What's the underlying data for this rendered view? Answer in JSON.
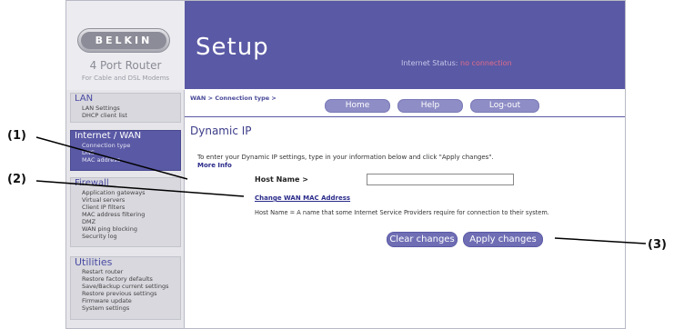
{
  "brand": {
    "logo": "BELKIN",
    "product": "4 Port Router",
    "subtitle": "For Cable and DSL Modems"
  },
  "header": {
    "title": "Setup",
    "internet_status_label": "Internet Status:",
    "internet_status_value": "no connection"
  },
  "nav": {
    "breadcrumb": "WAN > Connection type >",
    "home": "Home",
    "help": "Help",
    "logout": "Log-out"
  },
  "sidebar": {
    "lan": {
      "title": "LAN",
      "items": [
        "LAN Settings",
        "DHCP client list"
      ]
    },
    "internet_wan": {
      "title": "Internet / WAN",
      "items": [
        "Connection type",
        "DNS",
        "MAC address"
      ]
    },
    "firewall": {
      "title": "Firewall",
      "items": [
        "Application gateways",
        "Virtual servers",
        "Client IP filters",
        "MAC address filtering",
        "DMZ",
        "WAN ping blocking",
        "Security log"
      ]
    },
    "utilities": {
      "title": "Utilities",
      "items": [
        "Restart router",
        "Restore factory defaults",
        "Save/Backup current settings",
        "Restore previous settings",
        "Firmware update",
        "System settings"
      ]
    }
  },
  "main": {
    "heading": "Dynamic IP",
    "intro": "To enter your Dynamic IP settings, type in your information below and click \"Apply changes\".",
    "more_info": "More Info",
    "host_label": "Host Name >",
    "host_value": "",
    "change_mac_link": "Change WAN MAC Address",
    "description": "Host Name = A name that some Internet Service Providers require for connection to their system.",
    "clear_button": "Clear changes",
    "apply_button": "Apply changes"
  },
  "callouts": {
    "c1": "(1)",
    "c2": "(2)",
    "c3": "(3)"
  },
  "colors": {
    "accent": "#5a59a5",
    "button": "#6f6eb4",
    "status_alert": "#e06c8c",
    "active_item": "#f3c64a"
  }
}
